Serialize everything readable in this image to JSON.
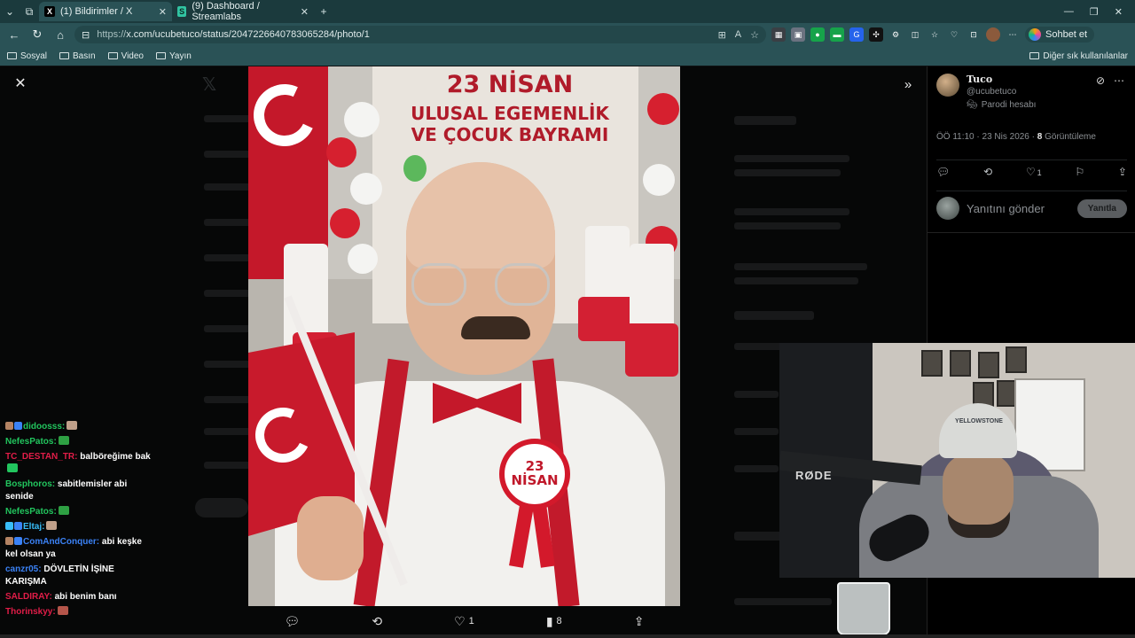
{
  "browser": {
    "tabs": [
      {
        "label": "(1) Bildirimler / X",
        "favicon": "X",
        "active": true
      },
      {
        "label": "(9) Dashboard / Streamlabs",
        "favicon": "S",
        "active": false
      }
    ],
    "new_tab": "+",
    "url_scheme": "https://",
    "url_rest": "x.com/ucubetuco/status/2047226640783065284/photo/1",
    "sohbet_label": "Sohbet et",
    "bookmarks": [
      "Sosyal",
      "Basın",
      "Video",
      "Yayın"
    ],
    "bookmarks_right": "Diğer sık kullanılanlar"
  },
  "photo": {
    "banner_line1": "23 NİSAN",
    "banner_line2": "ULUSAL EGEMENLİK",
    "banner_line3": "VE ÇOCUK BAYRAMI",
    "rosette_line1": "23",
    "rosette_line2": "NİSAN"
  },
  "photo_actions": {
    "likes": "1",
    "views": "8"
  },
  "tweet": {
    "author_name": "Tuco",
    "author_handle": "@ucubetuco",
    "parody_label": "Parodi hesabı",
    "timestamp": "ÖÖ 11:10 · 23 Nis 2026 ·",
    "view_count": "8",
    "view_label": "Görüntüleme",
    "like_count": "1",
    "reply_placeholder": "Yanıtını gönder",
    "reply_button": "Yanıtla"
  },
  "chat": [
    {
      "user": "didoosss:",
      "color": "#22c55e",
      "text": "",
      "emote": "#c0a08a",
      "badges": [
        "#b48363",
        "#3b82f6"
      ]
    },
    {
      "user": "NefesPatos:",
      "color": "#22c55e",
      "text": "",
      "emote": "#2ea043",
      "badges": []
    },
    {
      "user": "TC_DESTAN_TR:",
      "color": "#e11d48",
      "text": "balböreğime bak",
      "emote": "#22c55e",
      "badges": []
    },
    {
      "user": "Bosphoros:",
      "color": "#22c55e",
      "text": "sabitlemisler abi senide",
      "emote": "",
      "badges": []
    },
    {
      "user": "NefesPatos:",
      "color": "#22c55e",
      "text": "",
      "emote": "#2ea043",
      "badges": []
    },
    {
      "user": "Eltaj:",
      "color": "#38bdf8",
      "text": "",
      "emote": "#c0a08a",
      "badges": [
        "#38bdf8",
        "#3b82f6"
      ]
    },
    {
      "user": "ComAndConquer:",
      "color": "#3b82f6",
      "text": "abi keşke kel olsan ya",
      "emote": "",
      "badges": [
        "#b48363",
        "#3b82f6"
      ]
    },
    {
      "user": "canzr05:",
      "color": "#3b82f6",
      "text": "DÖVLETİN İŞİNE KARIŞMA",
      "emote": "",
      "badges": []
    },
    {
      "user": "SALDIRAY:",
      "color": "#e11d48",
      "text": "abi benim banı",
      "emote": "",
      "badges": []
    },
    {
      "user": "Thorinskyy:",
      "color": "#e11d48",
      "text": "",
      "emote": "#b4554a",
      "badges": []
    }
  ],
  "webcam": {
    "mic_brand": "RØDE",
    "cap_text": "YELLOWSTONE"
  },
  "colors": {
    "chrome_dark": "#1b3a3d",
    "chrome": "#2a5256",
    "turkish_red": "#c4182a"
  }
}
